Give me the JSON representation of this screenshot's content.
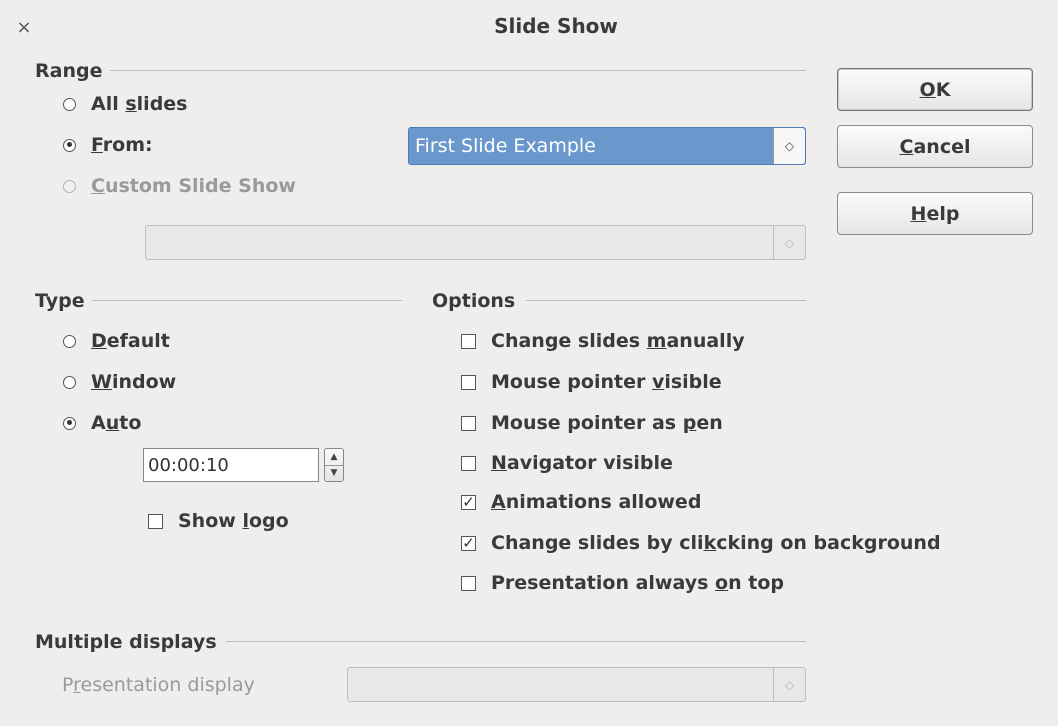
{
  "dialog": {
    "title": "Slide Show",
    "close_glyph": "×"
  },
  "range": {
    "label": "Range",
    "all_slides": {
      "pre": "All ",
      "u": "s",
      "post": "lides",
      "selected": false
    },
    "from": {
      "pre": "",
      "u": "F",
      "post": "rom:",
      "selected": true
    },
    "from_value": "First Slide Example",
    "custom": {
      "pre": "",
      "u": "C",
      "post": "ustom Slide Show",
      "selected": false,
      "enabled": false
    },
    "custom_value": ""
  },
  "buttons": {
    "ok": {
      "pre": "",
      "u": "O",
      "post": "K"
    },
    "cancel": {
      "pre": "",
      "u": "C",
      "post": "ancel"
    },
    "help": {
      "pre": "",
      "u": "H",
      "post": "elp"
    }
  },
  "type": {
    "label": "Type",
    "default": {
      "pre": "",
      "u": "D",
      "post": "efault",
      "selected": false
    },
    "window": {
      "pre": "",
      "u": "W",
      "post": "indow",
      "selected": false
    },
    "auto": {
      "pre": "A",
      "u": "u",
      "post": "to",
      "selected": true
    },
    "auto_time": "00:00:10",
    "show_logo": {
      "pre": "Show ",
      "u": "l",
      "post": "ogo",
      "checked": false
    }
  },
  "options": {
    "label": "Options",
    "items": [
      {
        "pre": "Change slides ",
        "u": "m",
        "post": "anually",
        "checked": false
      },
      {
        "pre": "Mouse pointer ",
        "u": "v",
        "post": "isible",
        "checked": false
      },
      {
        "pre": "Mouse pointer as ",
        "u": "p",
        "post": "en",
        "checked": false
      },
      {
        "pre": "",
        "u": "N",
        "post": "avigator visible",
        "checked": false
      },
      {
        "pre": "",
        "u": "A",
        "post": "nimations allowed",
        "checked": true
      },
      {
        "pre": "Change slides by cli",
        "u": "k",
        "post": "cking on background",
        "checked": true
      },
      {
        "pre": "Presentation always ",
        "u": "o",
        "post": "n top",
        "checked": false
      }
    ]
  },
  "multiple_displays": {
    "label": "Multiple displays",
    "presentation_display": {
      "pre": "P",
      "u": "r",
      "post": "esentation display"
    },
    "display_value": ""
  },
  "icons": {
    "spin_up": "▲",
    "spin_down": "▼",
    "combo_updown": "◇",
    "checkmark": "✓"
  }
}
